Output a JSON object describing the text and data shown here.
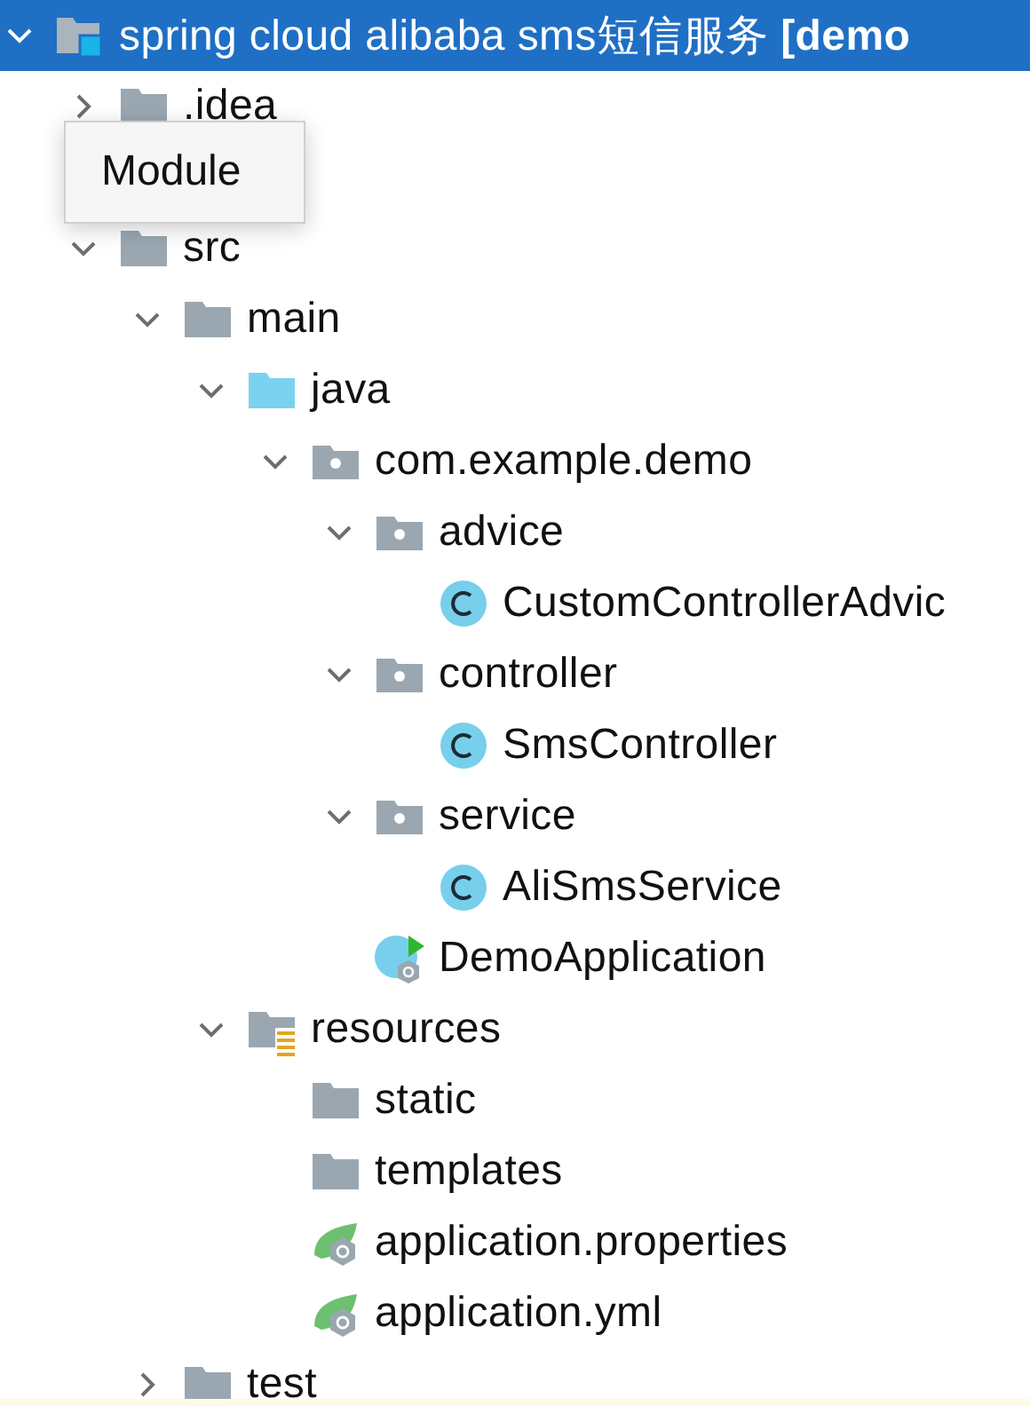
{
  "tree": {
    "label": "spring cloud alibaba sms短信服务 **[demo**",
    "kind": "module",
    "expanded": true,
    "selected": true,
    "children": [
      {
        "label": ".idea",
        "kind": "folder",
        "expanded": false,
        "selected": false
      },
      {
        "kind": "hidden"
      },
      {
        "label": "src",
        "kind": "folder",
        "expanded": true,
        "selected": false,
        "children": [
          {
            "label": "main",
            "kind": "folder",
            "expanded": true,
            "selected": false,
            "children": [
              {
                "label": "java",
                "kind": "source",
                "expanded": true,
                "selected": false,
                "children": [
                  {
                    "label": "com.example.demo",
                    "kind": "package",
                    "expanded": true,
                    "selected": false,
                    "children": [
                      {
                        "label": "advice",
                        "kind": "package",
                        "expanded": true,
                        "selected": false,
                        "children": [
                          {
                            "label": "CustomControllerAdvic",
                            "kind": "class",
                            "selected": false
                          }
                        ]
                      },
                      {
                        "label": "controller",
                        "kind": "package",
                        "expanded": true,
                        "selected": false,
                        "children": [
                          {
                            "label": "SmsController",
                            "kind": "class",
                            "selected": false
                          }
                        ]
                      },
                      {
                        "label": "service",
                        "kind": "package",
                        "expanded": true,
                        "selected": false,
                        "children": [
                          {
                            "label": "AliSmsService",
                            "kind": "class",
                            "selected": false
                          }
                        ]
                      },
                      {
                        "label": "DemoApplication",
                        "kind": "app",
                        "selected": false
                      }
                    ]
                  }
                ]
              },
              {
                "label": "resources",
                "kind": "resources",
                "expanded": true,
                "selected": false,
                "children": [
                  {
                    "label": "static",
                    "kind": "folder",
                    "selected": false
                  },
                  {
                    "label": "templates",
                    "kind": "folder",
                    "selected": false
                  },
                  {
                    "label": "application.properties",
                    "kind": "config",
                    "selected": false
                  },
                  {
                    "label": "application.yml",
                    "kind": "config",
                    "selected": false
                  }
                ]
              }
            ]
          },
          {
            "label": "test",
            "kind": "folder",
            "expanded": false,
            "selected": false
          }
        ]
      }
    ]
  },
  "tooltip": {
    "text": "Module"
  }
}
